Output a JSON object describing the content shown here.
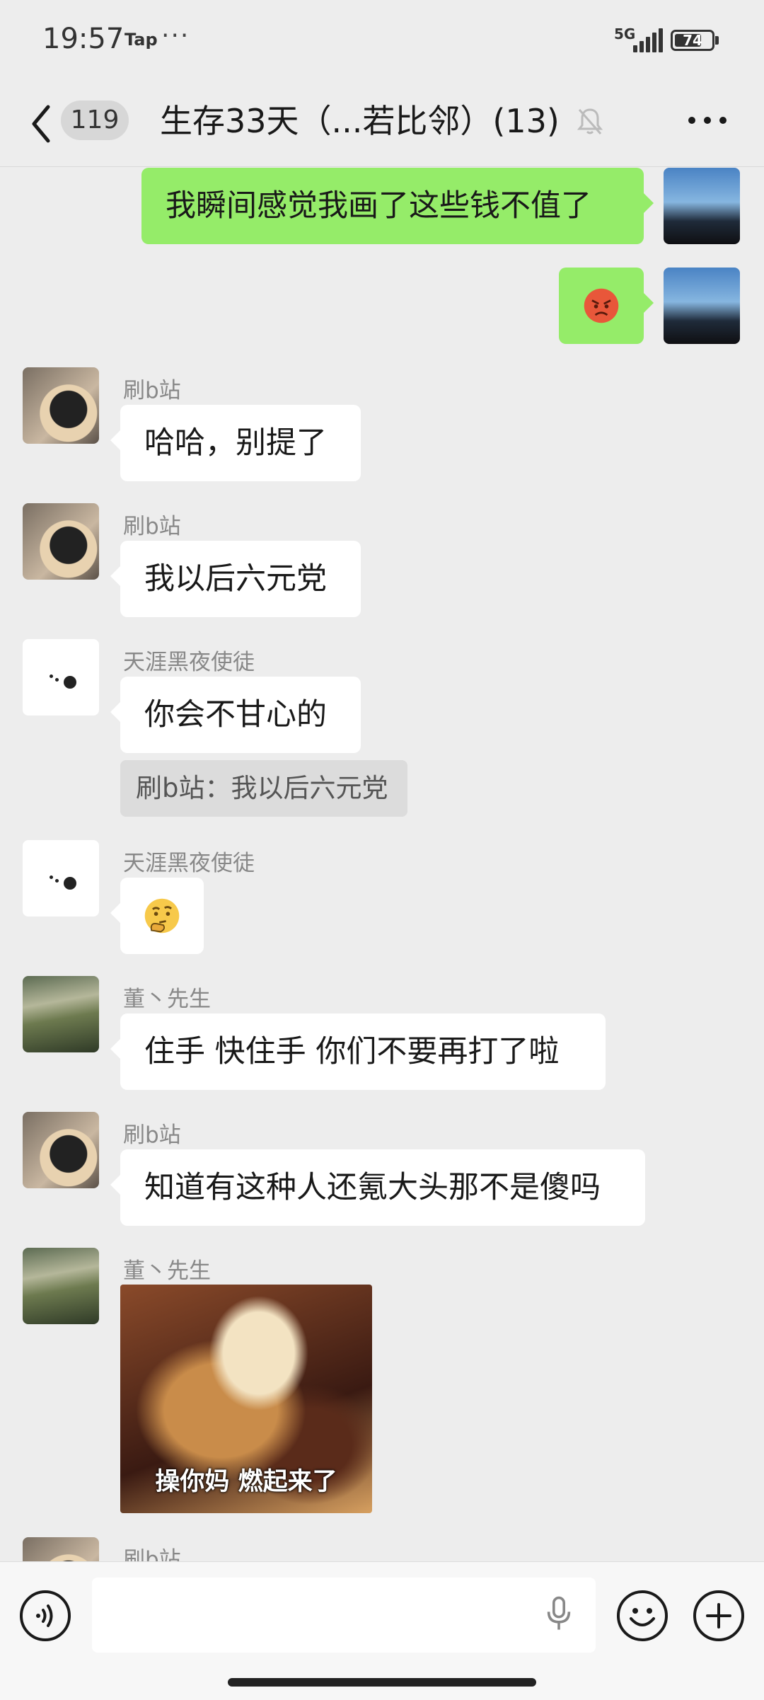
{
  "status_bar": {
    "time": "19:57",
    "app_tag": "Tap",
    "more": "···",
    "network": "5G",
    "battery": "74",
    "battery_level": 0.74
  },
  "nav": {
    "back_icon": "chevron-left-icon",
    "unread_count": "119",
    "title": "生存33天（...若比邻）(13)",
    "mute_icon": "bell-off-icon",
    "more_icon": "more-horizontal-icon"
  },
  "messages": [
    {
      "side": "out",
      "text": "我瞬间感觉我画了这些钱不值了"
    },
    {
      "side": "out",
      "emoji": "angry-face-icon"
    },
    {
      "side": "in",
      "sender": "刷b站",
      "text": "哈哈，别提了"
    },
    {
      "side": "in",
      "sender": "刷b站",
      "text": "我以后六元党"
    },
    {
      "side": "in",
      "sender": "天涯黑夜使徒",
      "text": "你会不甘心的",
      "quote": "刷b站：我以后六元党"
    },
    {
      "side": "in",
      "sender": "天涯黑夜使徒",
      "emoji": "thinking-face-icon"
    },
    {
      "side": "in",
      "sender": "董丶先生",
      "text": "住手 快住手 你们不要再打了啦"
    },
    {
      "side": "in",
      "sender": "刷b站",
      "text": "知道有这种人还氪大头那不是傻吗"
    },
    {
      "side": "in",
      "sender": "董丶先生",
      "sticker_caption": "操你妈 燃起来了"
    },
    {
      "side": "in",
      "sender": "刷b站"
    }
  ],
  "input_bar": {
    "voice_icon": "voice-icon",
    "mic_icon": "microphone-icon",
    "emoji_icon": "smiley-icon",
    "plus_icon": "plus-icon"
  },
  "colors": {
    "background": "#ededed",
    "outgoing_bubble": "#95ec69",
    "incoming_bubble": "#ffffff",
    "sender_name": "#888888"
  }
}
